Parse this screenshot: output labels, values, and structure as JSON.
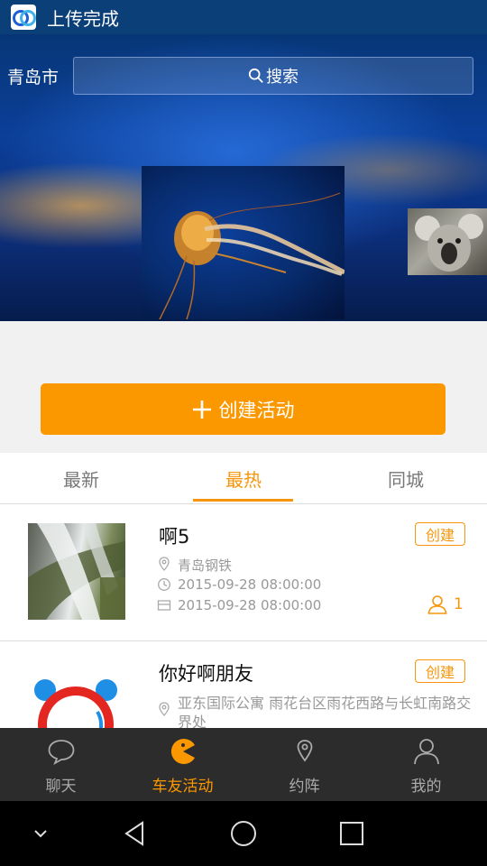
{
  "status_bar": {
    "notification_text": "上传完成"
  },
  "hero": {
    "city": "青岛市",
    "search_placeholder": "搜索"
  },
  "create_button": {
    "label": "创建活动"
  },
  "tabs": [
    {
      "label": "最新",
      "active": false
    },
    {
      "label": "最热",
      "active": true
    },
    {
      "label": "同城",
      "active": false
    }
  ],
  "activities": [
    {
      "title": "啊5",
      "badge": "创建",
      "location": "青岛钢铁",
      "start_time": "2015-09-28 08:00:00",
      "end_time": "2015-09-28 08:00:00",
      "participants": "1"
    },
    {
      "title": "你好啊朋友",
      "badge": "创建",
      "location": "亚东国际公寓 雨花台区雨花西路与长虹南路交界处"
    }
  ],
  "bottom_nav": [
    {
      "label": "聊天",
      "icon": "chat-bubble-icon",
      "active": false
    },
    {
      "label": "车友活动",
      "icon": "pacman-icon",
      "active": true
    },
    {
      "label": "约阵",
      "icon": "location-pin-icon",
      "active": false
    },
    {
      "label": "我的",
      "icon": "person-icon",
      "active": false
    }
  ],
  "colors": {
    "accent": "#fb9800",
    "status_bar": "#0a3f78",
    "nav_background": "#2c2c2c"
  }
}
